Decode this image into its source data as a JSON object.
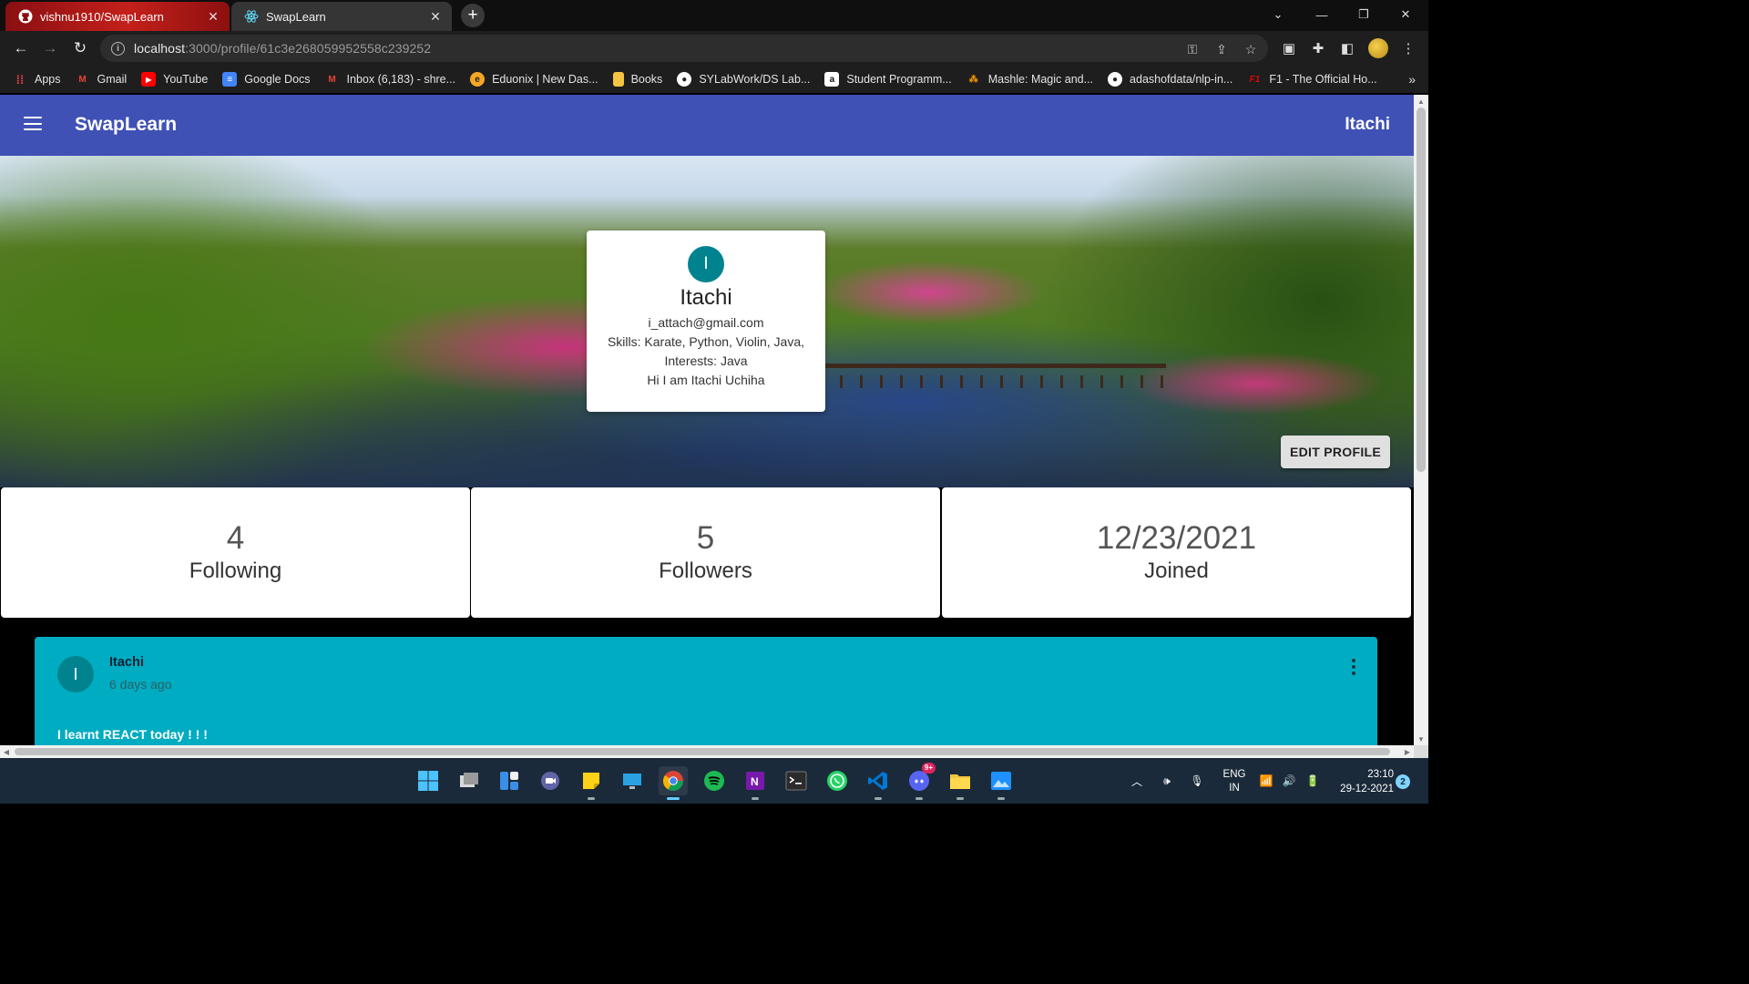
{
  "browser": {
    "tabs": [
      {
        "label": "vishnu1910/SwapLearn",
        "icon": "github-icon"
      },
      {
        "label": "SwapLearn",
        "icon": "react-icon"
      }
    ],
    "url_host": "localhost",
    "url_rest": ":3000/profile/61c3e268059952558c239252",
    "bookmarks": [
      {
        "label": "Apps",
        "icon": "apps-grid-icon"
      },
      {
        "label": "Gmail",
        "icon": "gmail-icon"
      },
      {
        "label": "YouTube",
        "icon": "youtube-icon"
      },
      {
        "label": "Google Docs",
        "icon": "docs-icon"
      },
      {
        "label": "Inbox (6,183) - shre...",
        "icon": "gmail-icon"
      },
      {
        "label": "Eduonix | New Das...",
        "icon": "eduonix-icon"
      },
      {
        "label": "Books",
        "icon": "folder-icon"
      },
      {
        "label": "SYLabWork/DS Lab...",
        "icon": "github-icon"
      },
      {
        "label": "Student Programm...",
        "icon": "amazon-icon"
      },
      {
        "label": "Mashle: Magic and...",
        "icon": "mashle-icon"
      },
      {
        "label": "adashofdata/nlp-in...",
        "icon": "github-icon"
      },
      {
        "label": "F1 - The Official Ho...",
        "icon": "f1-icon"
      }
    ]
  },
  "app": {
    "brand": "SwapLearn",
    "current_user": "Itachi"
  },
  "profile": {
    "avatar_letter": "I",
    "name": "Itachi",
    "email": "i_attach@gmail.com",
    "skills": "Skills: Karate, Python, Violin, Java,",
    "interests": "Interests: Java",
    "bio": "Hi I am Itachi Uchiha",
    "edit_label": "EDIT PROFILE"
  },
  "stats": [
    {
      "value": "4",
      "label": "Following"
    },
    {
      "value": "5",
      "label": "Followers"
    },
    {
      "value": "12/23/2021",
      "label": "Joined"
    }
  ],
  "post": {
    "avatar_letter": "I",
    "author": "Itachi",
    "time": "6 days ago",
    "text": "I learnt REACT today ! ! !"
  },
  "taskbar": {
    "lang_line1": "ENG",
    "lang_line2": "IN",
    "time": "23:10",
    "date": "29-12-2021",
    "notifications": "2",
    "discord_badge": "9+"
  },
  "colors": {
    "appbar": "#3f51b5",
    "post_bg": "#00acc1",
    "avatar": "#00838f"
  }
}
